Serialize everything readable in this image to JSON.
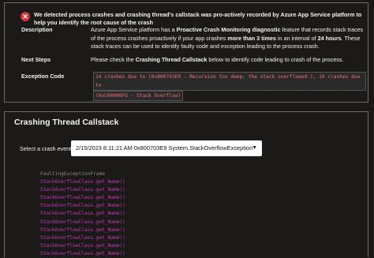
{
  "alert": {
    "headline": "We detected process crashes and crashing thread's callstack was pro-actively recorded by Azure App Service platform to help you identify the root cause of the crash",
    "description_label": "Description",
    "description": {
      "p1": "Azure App Service platform has a ",
      "b1": "Proactive Crash Monitoring diagnostic",
      "p2": " feature that records stack traces of the process crashes proactively if your app crashes ",
      "b2": "more than 3 times",
      "p3": " in an interval of ",
      "b3": "24 hours",
      "p4": ". These stack traces can be used to identify faulty code and exception leading to the process crash."
    },
    "next_steps_label": "Next Steps",
    "next_steps": {
      "p1": "Please check the ",
      "b1": "Crashing Thread Callstack",
      "p2": " below to identify code leading to crash of the process."
    },
    "exception_label": "Exception Code",
    "exception_line1": "14 crashes due to (0x800703E9 - Recursion too deep; the stack overflowed.), 10 crashes due to",
    "exception_line2": "(0xC00000FD - Stack Overflow)"
  },
  "callstack": {
    "title": "Crashing Thread Callstack",
    "select_label": "Select a crash event",
    "selected_event": "2/15/2023 8:11:21 AM 0x800703E9 System.StackOverflowException",
    "frames": [
      "FaultingExceptionFrame",
      "StackOverflowClass.get_Name()",
      "StackOverflowClass.get_Name()",
      "StackOverflowClass.get_Name()",
      "StackOverflowClass.get_Name()",
      "StackOverflowClass.get_Name()",
      "StackOverflowClass.get_Name()",
      "StackOverflowClass.get_Name()",
      "StackOverflowClass.get_Name()",
      "StackOverflowClass.get_Name()",
      "StackOverflowClass.get_Name()"
    ]
  },
  "colors": {
    "error": "#d13438",
    "frame": "#c239b3",
    "exception": "#f1707b"
  },
  "icons": {
    "alert": "error-circle-icon",
    "dropdown": "chevron-down-icon"
  }
}
